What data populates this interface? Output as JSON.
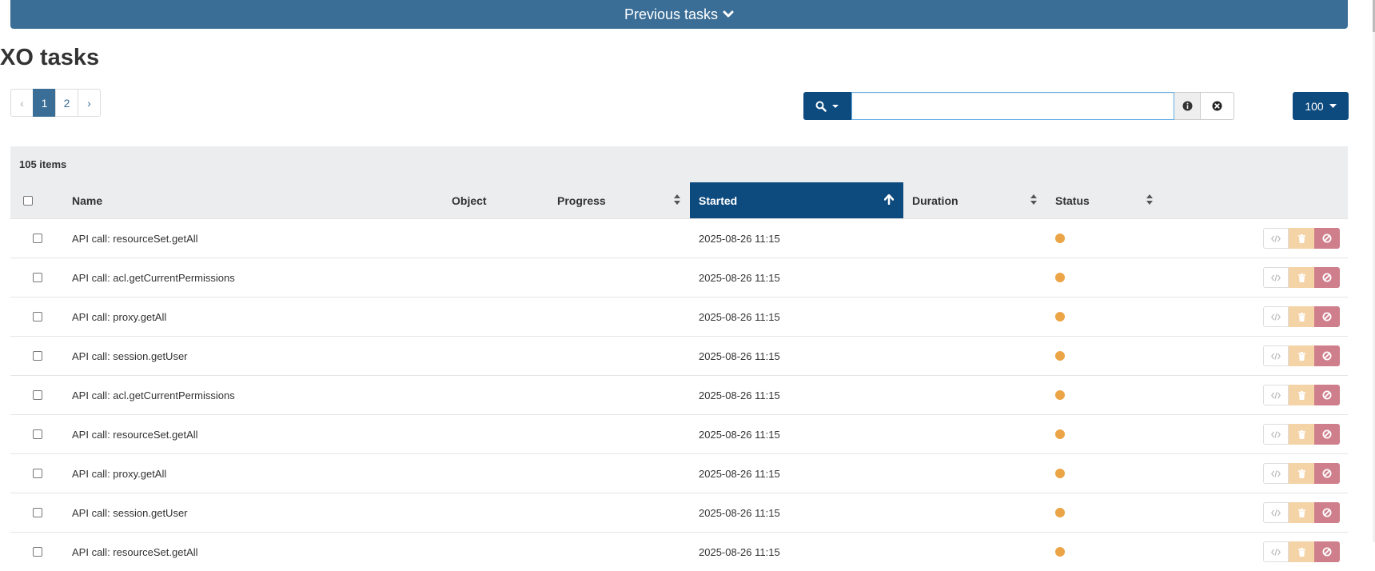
{
  "banner": {
    "label": "Previous tasks",
    "icon": "chevron-down-icon"
  },
  "title": "XO tasks",
  "pagination": {
    "prev": "‹",
    "pages": [
      "1",
      "2"
    ],
    "active": "1",
    "next": "›"
  },
  "search": {
    "value": "",
    "placeholder": "",
    "icon": "search-icon",
    "info_icon": "info-circle-icon",
    "clear_icon": "times-circle-icon"
  },
  "per_page": {
    "label": "100"
  },
  "table": {
    "items_count": "105 items",
    "columns": {
      "name": "Name",
      "object": "Object",
      "progress": "Progress",
      "started": "Started",
      "duration": "Duration",
      "status": "Status"
    },
    "sorted_column": "Started",
    "sort_direction": "ascending",
    "rows": [
      {
        "name": "API call: resourceSet.getAll",
        "started": "2025-08-26 11:15",
        "status": "pending"
      },
      {
        "name": "API call: acl.getCurrentPermissions",
        "started": "2025-08-26 11:15",
        "status": "pending"
      },
      {
        "name": "API call: proxy.getAll",
        "started": "2025-08-26 11:15",
        "status": "pending"
      },
      {
        "name": "API call: session.getUser",
        "started": "2025-08-26 11:15",
        "status": "pending"
      },
      {
        "name": "API call: acl.getCurrentPermissions",
        "started": "2025-08-26 11:15",
        "status": "pending"
      },
      {
        "name": "API call: resourceSet.getAll",
        "started": "2025-08-26 11:15",
        "status": "pending"
      },
      {
        "name": "API call: proxy.getAll",
        "started": "2025-08-26 11:15",
        "status": "pending"
      },
      {
        "name": "API call: session.getUser",
        "started": "2025-08-26 11:15",
        "status": "pending"
      },
      {
        "name": "API call: resourceSet.getAll",
        "started": "2025-08-26 11:15",
        "status": "pending"
      }
    ]
  },
  "colors": {
    "primary": "#0d4a7e",
    "banner": "#3b6e96",
    "status_pending": "#eba446",
    "danger": "#cf7f8c",
    "warning": "#f4d3a6"
  }
}
